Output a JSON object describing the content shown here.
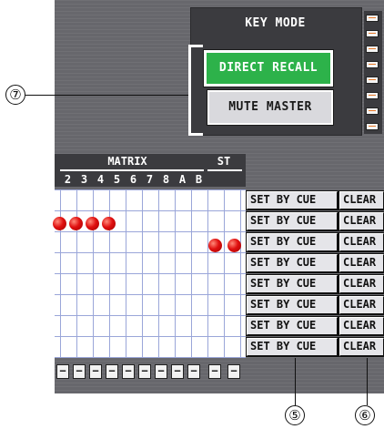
{
  "key_mode": {
    "title": "KEY MODE",
    "direct_recall_label": "DIRECT RECALL",
    "mute_master_label": "MUTE MASTER",
    "direct_recall_active": true
  },
  "callouts": {
    "seven": "⑦",
    "five": "⑤",
    "six": "⑥"
  },
  "matrix": {
    "group_label": "MATRIX",
    "st_label": "ST",
    "column_labels": [
      "2",
      "3",
      "4",
      "5",
      "6",
      "7",
      "8",
      "A",
      "B"
    ],
    "minus_label": "−"
  },
  "rows": [
    {
      "set_by_cue": "SET BY CUE",
      "clear": "CLEAR"
    },
    {
      "set_by_cue": "SET BY CUE",
      "clear": "CLEAR"
    },
    {
      "set_by_cue": "SET BY CUE",
      "clear": "CLEAR"
    },
    {
      "set_by_cue": "SET BY CUE",
      "clear": "CLEAR"
    },
    {
      "set_by_cue": "SET BY CUE",
      "clear": "CLEAR"
    },
    {
      "set_by_cue": "SET BY CUE",
      "clear": "CLEAR"
    },
    {
      "set_by_cue": "SET BY CUE",
      "clear": "CLEAR"
    },
    {
      "set_by_cue": "SET BY CUE",
      "clear": "CLEAR"
    }
  ],
  "active_cells": {
    "row_2": [
      "1",
      "2",
      "3",
      "4"
    ],
    "row_3": [
      "A",
      "B"
    ]
  },
  "colors": {
    "screen_bg": "#67676c",
    "panel_dark": "#3b3b3f",
    "recall_green": "#2db24a",
    "grid_line": "#9aa6d9",
    "indicator_red": "#e01010"
  }
}
